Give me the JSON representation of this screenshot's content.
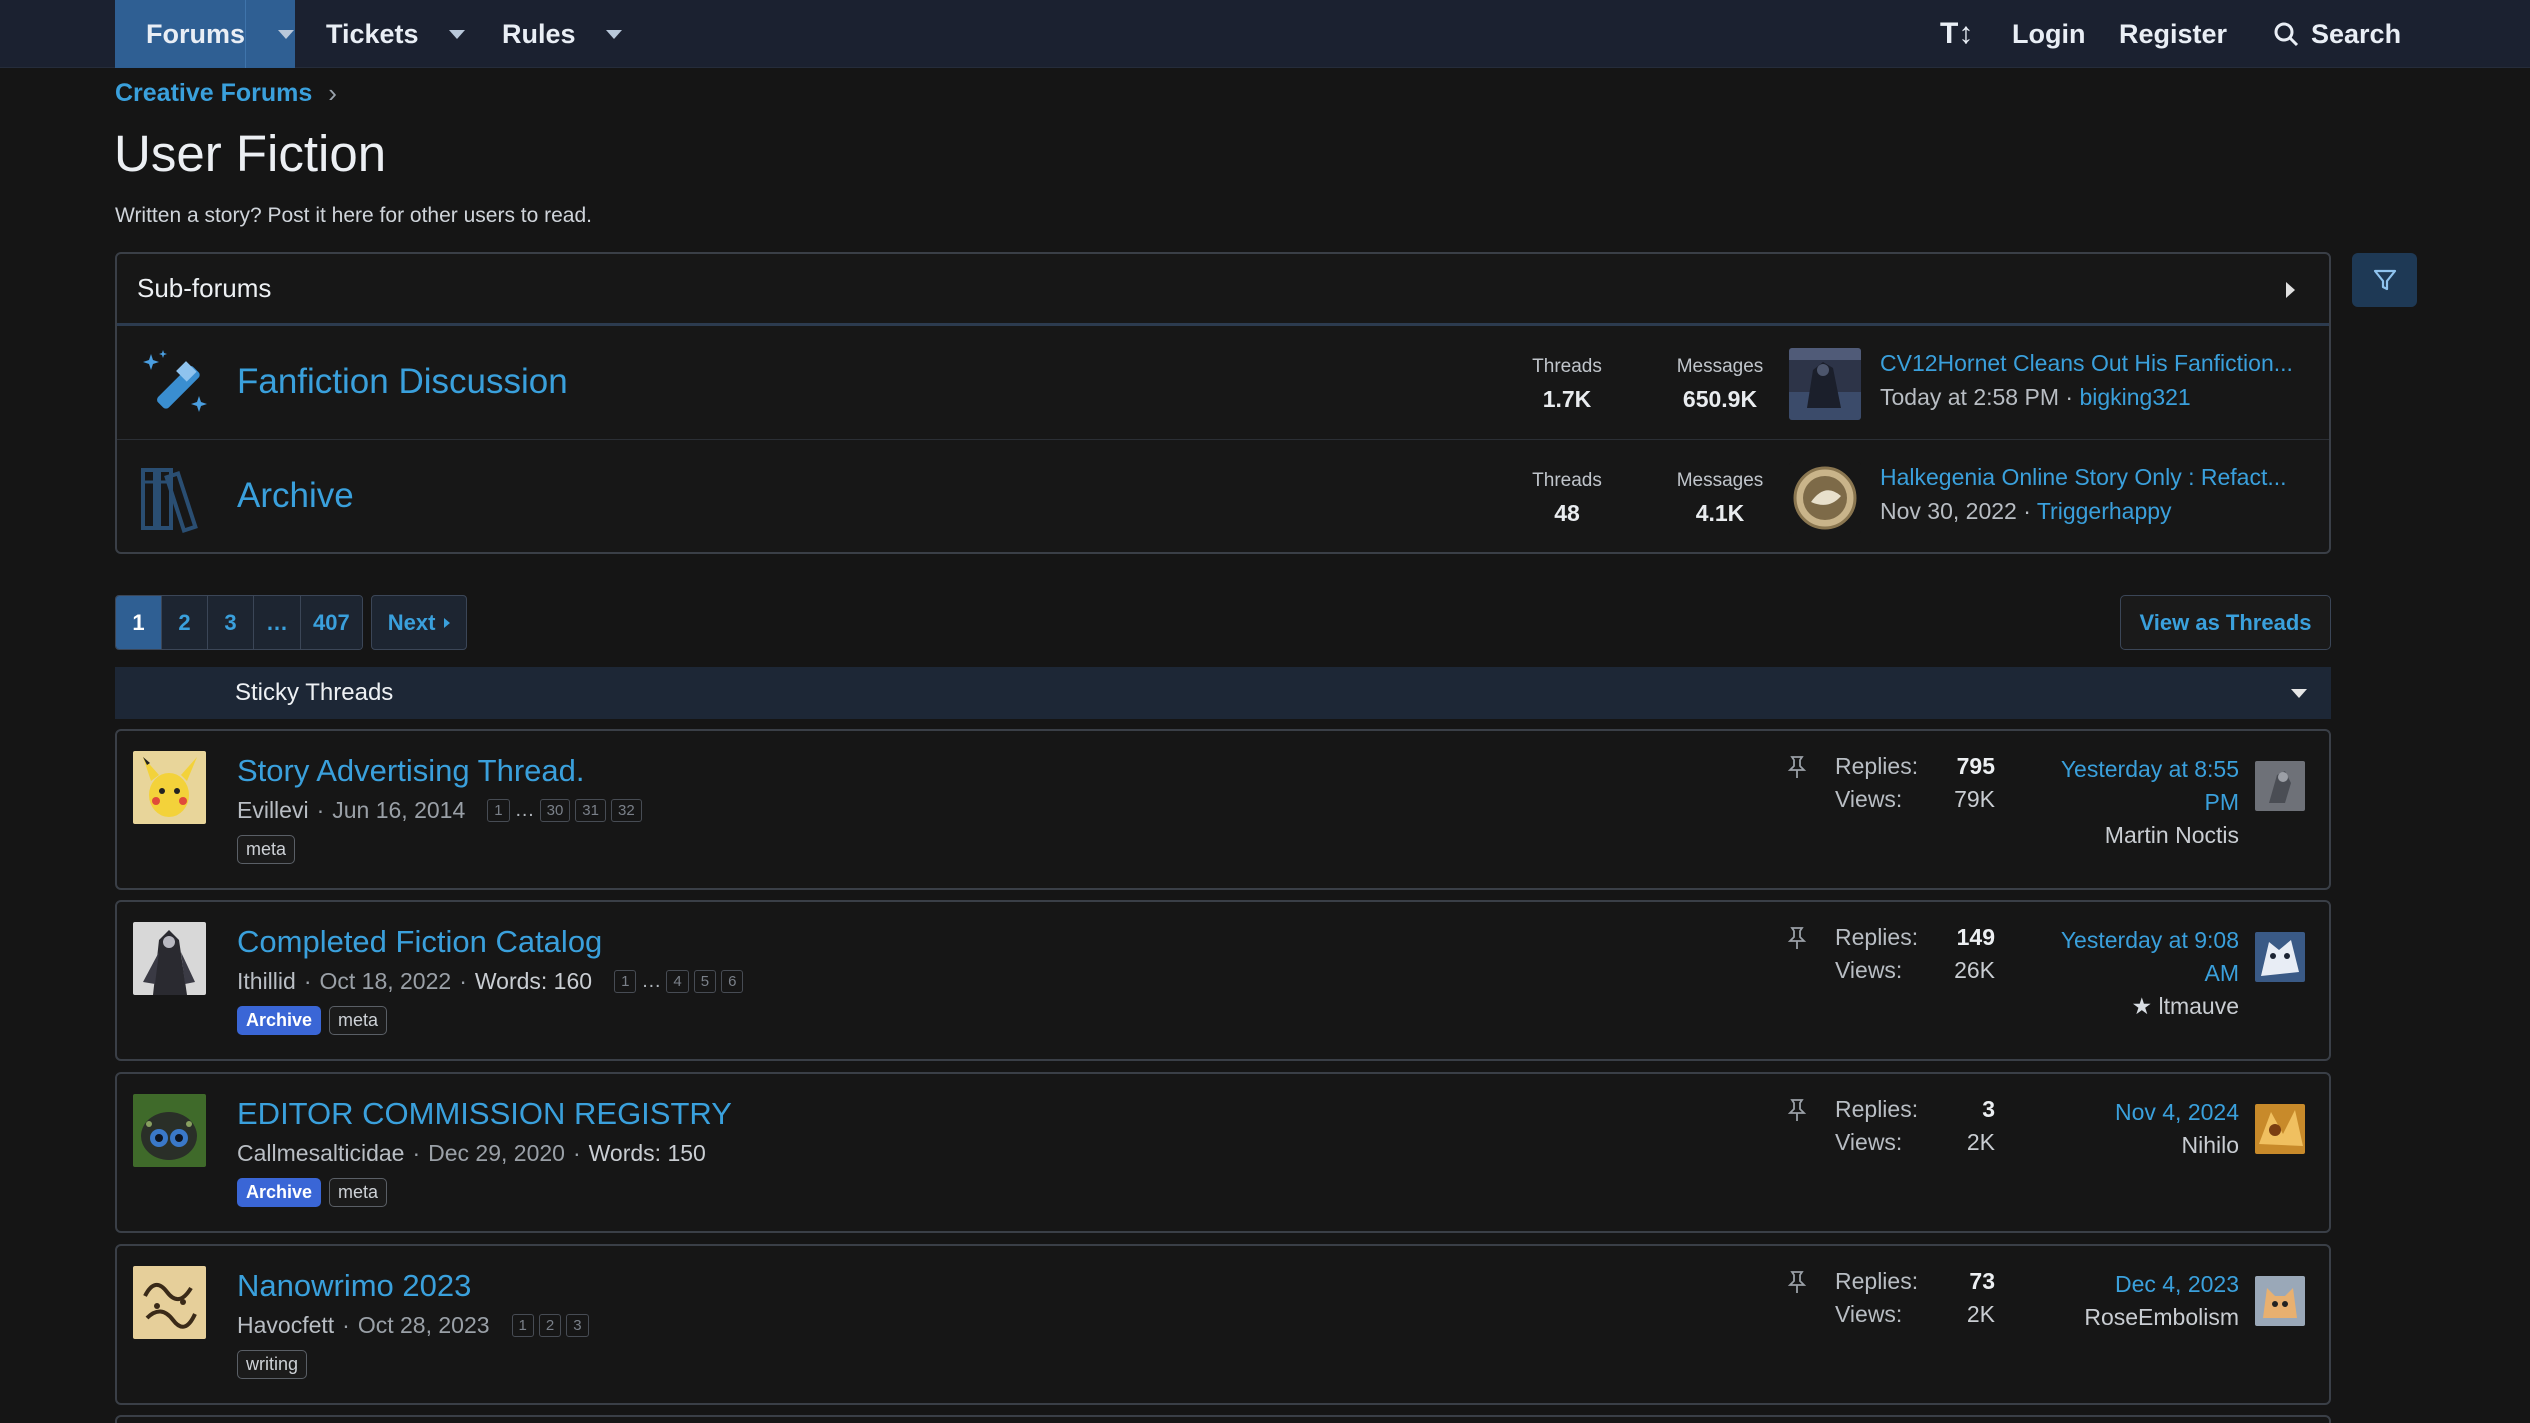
{
  "nav": {
    "forums": "Forums",
    "tickets": "Tickets",
    "rules": "Rules",
    "text_size": "T↕",
    "login": "Login",
    "register": "Register",
    "search": "Search"
  },
  "breadcrumb": {
    "item": "Creative Forums",
    "sep": "›"
  },
  "page": {
    "title": "User Fiction",
    "description": "Written a story? Post it here for other users to read."
  },
  "subforums": {
    "heading": "Sub-forums",
    "items": [
      {
        "title": "Fanfiction Discussion",
        "threads_label": "Threads",
        "threads": "1.7K",
        "messages_label": "Messages",
        "messages": "650.9K",
        "last_title": "CV12Hornet Cleans Out His Fanfiction...",
        "last_date": "Today at 2:58 PM",
        "last_user": "bigking321",
        "icon": "magic-wand-icon"
      },
      {
        "title": "Archive",
        "threads_label": "Threads",
        "threads": "48",
        "messages_label": "Messages",
        "messages": "4.1K",
        "last_title": "Halkegenia Online Story Only : Refact...",
        "last_date": "Nov 30, 2022",
        "last_user": "Triggerhappy",
        "icon": "books-icon"
      }
    ]
  },
  "pagination": {
    "pages": [
      "1",
      "2",
      "3",
      "…",
      "407"
    ],
    "next": "Next",
    "view_as_threads": "View as Threads"
  },
  "sticky": {
    "heading": "Sticky Threads",
    "threads": [
      {
        "title": "Story Advertising Thread.",
        "author": "Evillevi",
        "date": "Jun 16, 2014",
        "words": "",
        "pages": [
          "1",
          "…",
          "30",
          "31",
          "32"
        ],
        "tags": [
          {
            "label": "meta",
            "archive": false
          }
        ],
        "replies_label": "Replies:",
        "replies": "795",
        "views_label": "Views:",
        "views": "79K",
        "last_date": "Yesterday at 8:55 PM",
        "last_user": "Martin Noctis"
      },
      {
        "title": "Completed Fiction Catalog",
        "author": "Ithillid",
        "date": "Oct 18, 2022",
        "words": "Words: 160",
        "pages": [
          "1",
          "…",
          "4",
          "5",
          "6"
        ],
        "tags": [
          {
            "label": "Archive",
            "archive": true
          },
          {
            "label": "meta",
            "archive": false
          }
        ],
        "replies_label": "Replies:",
        "replies": "149",
        "views_label": "Views:",
        "views": "26K",
        "last_date": "Yesterday at 9:08 AM",
        "last_user": "ltmauve",
        "last_user_star": "★"
      },
      {
        "title": "EDITOR COMMISSION REGISTRY",
        "author": "Callmesalticidae",
        "date": "Dec 29, 2020",
        "words": "Words: 150",
        "pages": [],
        "tags": [
          {
            "label": "Archive",
            "archive": true
          },
          {
            "label": "meta",
            "archive": false
          }
        ],
        "replies_label": "Replies:",
        "replies": "3",
        "views_label": "Views:",
        "views": "2K",
        "last_date": "Nov 4, 2024",
        "last_user": "Nihilo"
      },
      {
        "title": "Nanowrimo 2023",
        "author": "Havocfett",
        "date": "Oct 28, 2023",
        "words": "",
        "pages": [
          "1",
          "2",
          "3"
        ],
        "tags": [
          {
            "label": "writing",
            "archive": false
          }
        ],
        "replies_label": "Replies:",
        "replies": "73",
        "views_label": "Views:",
        "views": "2K",
        "last_date": "Dec 4, 2023",
        "last_user": "RoseEmbolism"
      }
    ]
  },
  "colors": {
    "background": "#151515",
    "nav": "#1b2130",
    "accent": "#3aa0dc",
    "active_tab": "#2f5f93",
    "archive_tag": "#3a66d6"
  }
}
